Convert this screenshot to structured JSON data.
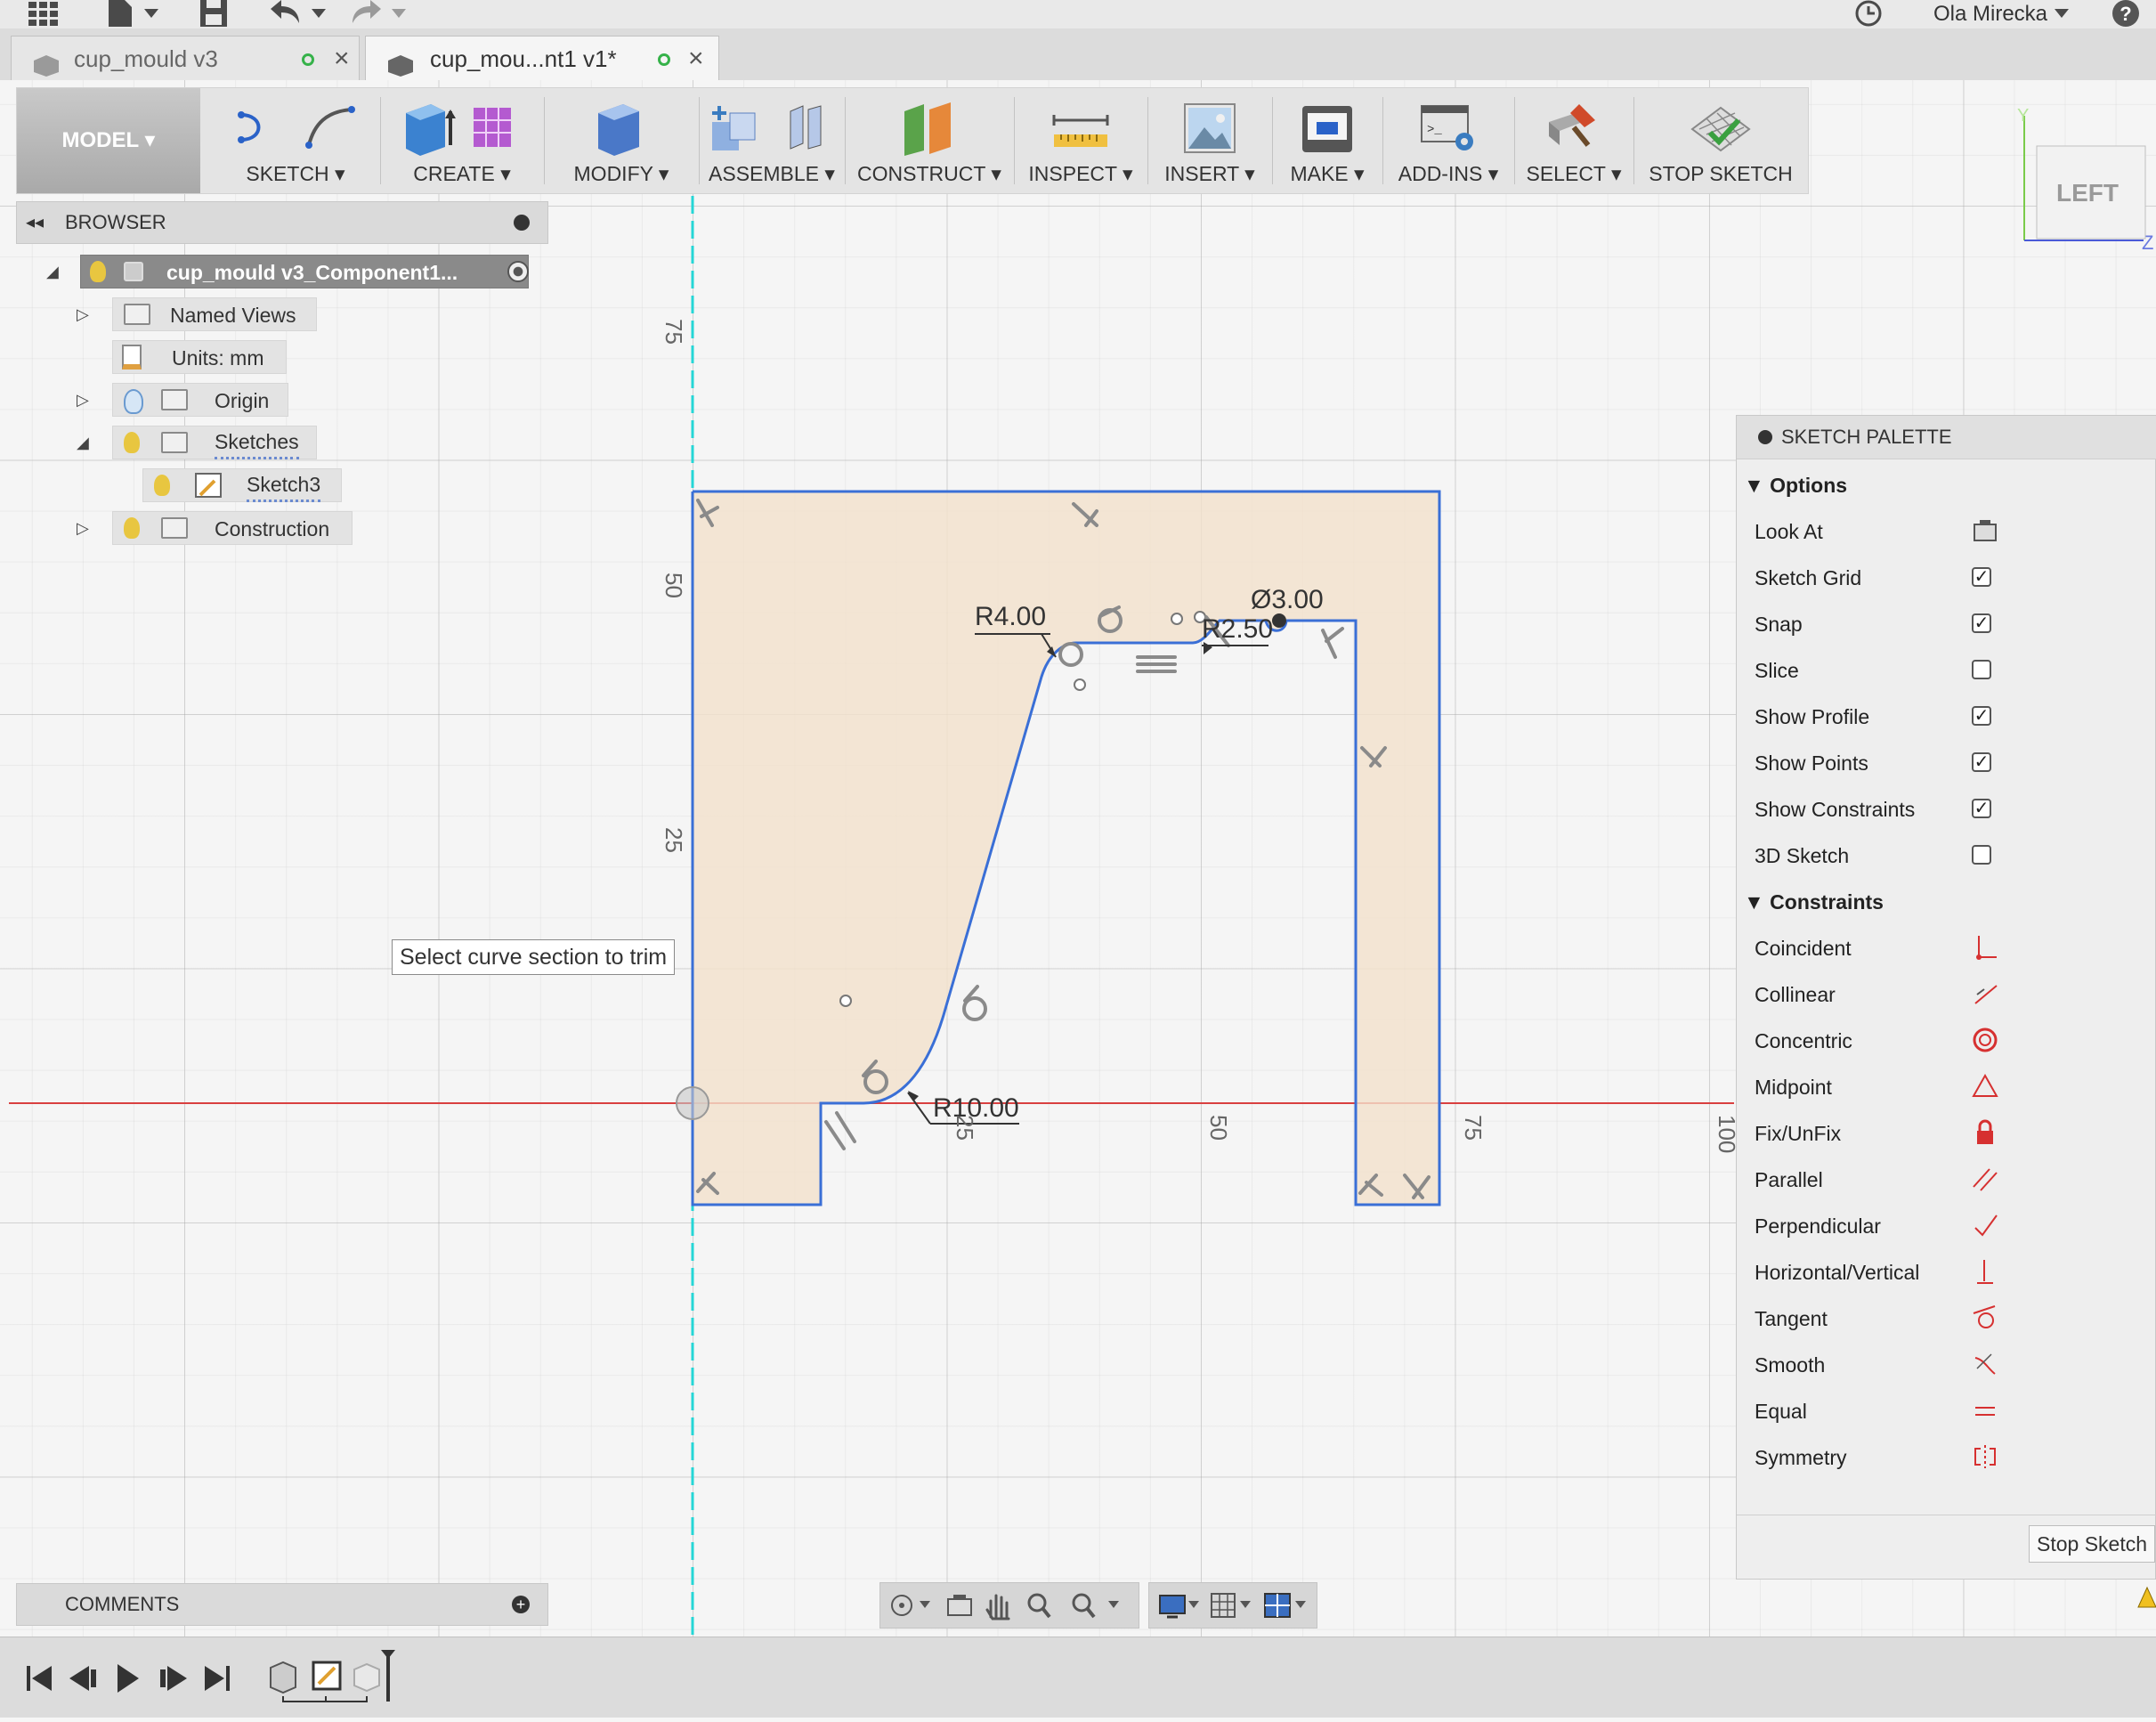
{
  "topbar": {
    "user_name": "Ola Mirecka"
  },
  "tabs": [
    {
      "label": "cup_mould v3",
      "active": false
    },
    {
      "label": "cup_mou...nt1 v1*",
      "active": true
    }
  ],
  "toolbar": {
    "model_label": "MODEL",
    "groups": [
      "SKETCH",
      "CREATE",
      "MODIFY",
      "ASSEMBLE",
      "CONSTRUCT",
      "INSPECT",
      "INSERT",
      "MAKE",
      "ADD-INS",
      "SELECT",
      "STOP SKETCH"
    ]
  },
  "viewcube": {
    "face": "LEFT",
    "axis_y": "Y",
    "axis_z": "Z"
  },
  "browser": {
    "title": "BROWSER",
    "items": [
      {
        "label": "cup_mould v3_Component1..."
      },
      {
        "label": "Named Views"
      },
      {
        "label": "Units: mm"
      },
      {
        "label": "Origin"
      },
      {
        "label": "Sketches"
      },
      {
        "label": "Sketch3"
      },
      {
        "label": "Construction"
      }
    ]
  },
  "comments": {
    "title": "COMMENTS"
  },
  "tooltip": "Select curve section to trim",
  "sketch": {
    "dimensions": {
      "r4": "R4.00",
      "r25": "R2.50",
      "d3": "Ø3.00",
      "r10": "R10.00"
    },
    "ruler_v": [
      "75",
      "50",
      "25"
    ],
    "ruler_h": [
      "25",
      "50",
      "75",
      "100"
    ]
  },
  "palette": {
    "title": "SKETCH PALETTE",
    "options_title": "Options",
    "options": [
      {
        "label": "Look At",
        "checked": null,
        "icon": "look-at-icon"
      },
      {
        "label": "Sketch Grid",
        "checked": true
      },
      {
        "label": "Snap",
        "checked": true
      },
      {
        "label": "Slice",
        "checked": false
      },
      {
        "label": "Show Profile",
        "checked": true
      },
      {
        "label": "Show Points",
        "checked": true
      },
      {
        "label": "Show Constraints",
        "checked": true
      },
      {
        "label": "3D Sketch",
        "checked": false
      }
    ],
    "constraints_title": "Constraints",
    "constraints": [
      {
        "label": "Coincident",
        "icon": "coincident-icon"
      },
      {
        "label": "Collinear",
        "icon": "collinear-icon"
      },
      {
        "label": "Concentric",
        "icon": "concentric-icon"
      },
      {
        "label": "Midpoint",
        "icon": "midpoint-icon"
      },
      {
        "label": "Fix/UnFix",
        "icon": "lock-icon"
      },
      {
        "label": "Parallel",
        "icon": "parallel-icon"
      },
      {
        "label": "Perpendicular",
        "icon": "perpendicular-icon"
      },
      {
        "label": "Horizontal/Vertical",
        "icon": "horizontal-vertical-icon"
      },
      {
        "label": "Tangent",
        "icon": "tangent-icon"
      },
      {
        "label": "Smooth",
        "icon": "smooth-icon"
      },
      {
        "label": "Equal",
        "icon": "equal-icon"
      },
      {
        "label": "Symmetry",
        "icon": "symmetry-icon"
      }
    ],
    "stop_button": "Stop Sketch"
  },
  "colors": {
    "sketch_line": "#3a6fd6",
    "profile_fill": "#f3e1cc",
    "axis_red": "#d94040",
    "axis_cyan": "#25d6d6",
    "constraint_red": "#d63030"
  }
}
